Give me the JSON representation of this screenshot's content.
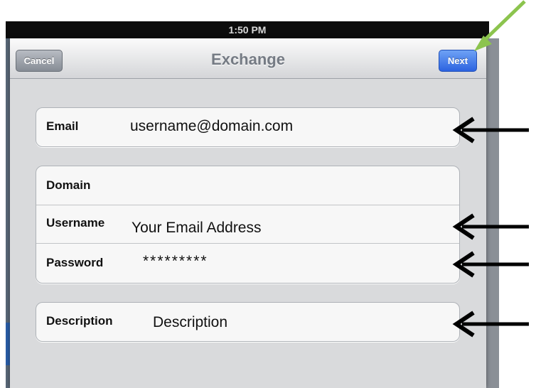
{
  "statusbar": {
    "time": "1:50 PM"
  },
  "navbar": {
    "title": "Exchange",
    "cancel_label": "Cancel",
    "next_label": "Next"
  },
  "form": {
    "email": {
      "label": "Email",
      "value": "username@domain.com"
    },
    "domain": {
      "label": "Domain",
      "value": ""
    },
    "username": {
      "label": "Username",
      "value": "Your Email Address"
    },
    "password": {
      "label": "Password",
      "value": "*********"
    },
    "description": {
      "label": "Description",
      "value": "Description"
    }
  },
  "annotations": {
    "arrow_color": "#000000",
    "highlight_arrow_color": "#8cc44e"
  }
}
